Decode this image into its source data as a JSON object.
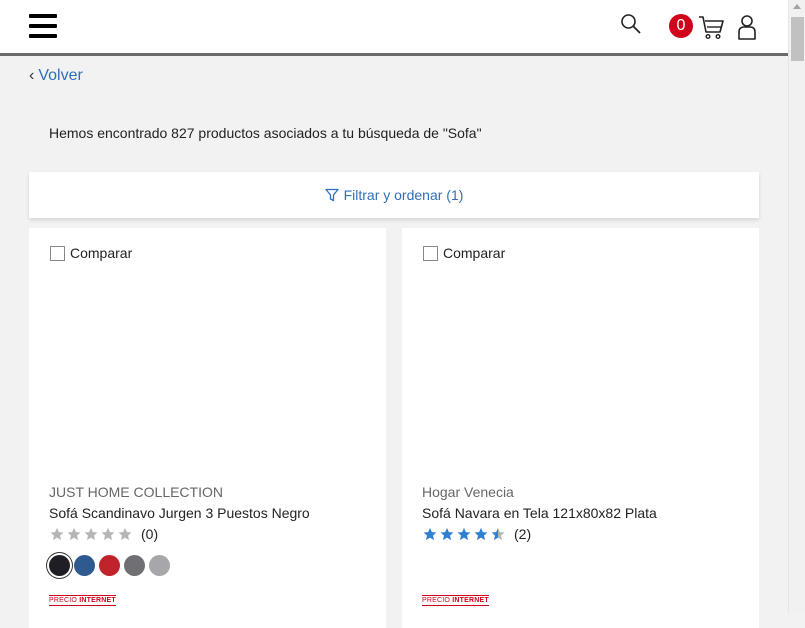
{
  "header": {
    "menu_icon": "hamburger-menu-icon",
    "search_icon": "search-icon",
    "cart_count": "0",
    "cart_icon": "shopping-cart-icon",
    "user_icon": "user-icon"
  },
  "nav": {
    "back_label": "Volver"
  },
  "results": {
    "message": "Hemos encontrado 827 productos asociados a tu búsqueda de \"Sofa\""
  },
  "filter": {
    "label": "Filtrar y ordenar (1)"
  },
  "products": [
    {
      "compare_label": "Comparar",
      "brand": "JUST HOME COLLECTION",
      "name": "Sofá Scandinavo Jurgen 3 Puestos Negro",
      "rating": 0,
      "reviews": "(0)",
      "swatches": [
        "#1e1e24",
        "#2f5a8f",
        "#c0232a",
        "#707074",
        "#a8a6aa"
      ],
      "price_tag_prefix": "PRECIO",
      "price_tag_strong": "INTERNET"
    },
    {
      "compare_label": "Comparar",
      "brand": "Hogar Venecia",
      "name": "Sofá Navara en Tela 121x80x82 Plata",
      "rating": 4.5,
      "reviews": "(2)",
      "price_tag_prefix": "PRECIO",
      "price_tag_strong": "INTERNET"
    }
  ],
  "colors": {
    "accent": "#2f6eba",
    "badge": "#d0021b",
    "star_on": "#2f7fd1",
    "star_off": "#b5b5b5"
  }
}
